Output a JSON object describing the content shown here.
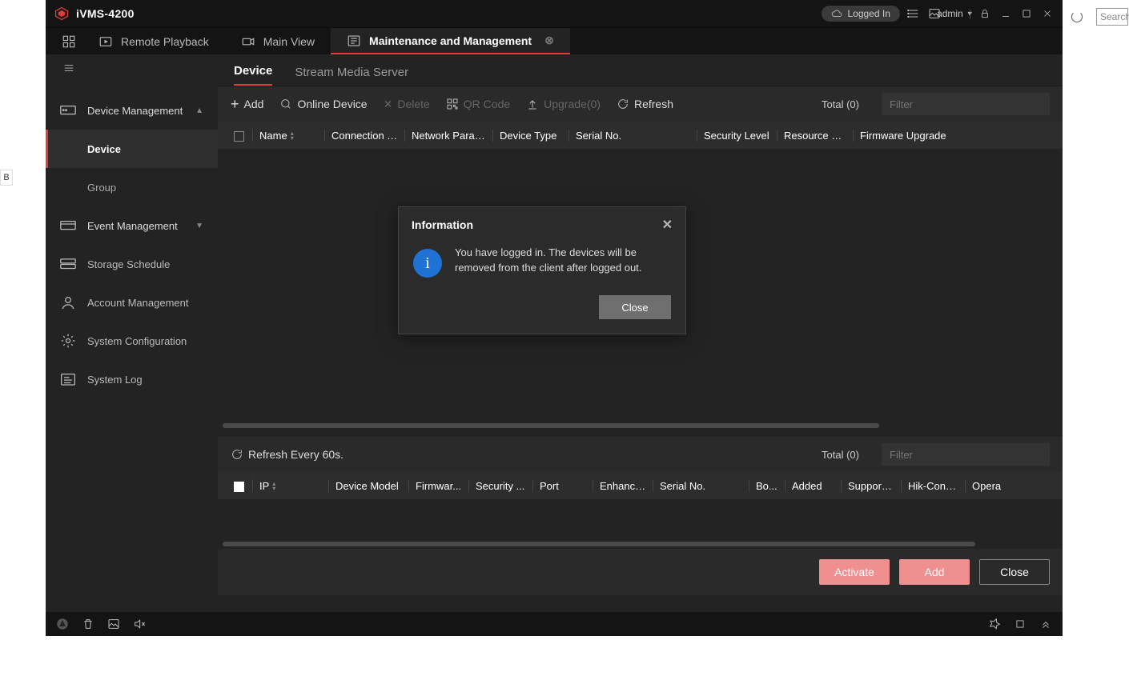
{
  "app": {
    "title": "iVMS-4200"
  },
  "titlebar": {
    "logged_pill": "Logged In",
    "user": "admin"
  },
  "tabs": {
    "remote_playback": "Remote Playback",
    "main_view": "Main View",
    "maintenance": "Maintenance and Management"
  },
  "sidebar": {
    "device_management": "Device Management",
    "device": "Device",
    "group": "Group",
    "event_management": "Event Management",
    "storage_schedule": "Storage Schedule",
    "account_management": "Account Management",
    "system_configuration": "System Configuration",
    "system_log": "System Log"
  },
  "subtabs": {
    "device": "Device",
    "sms": "Stream Media Server"
  },
  "toolbar": {
    "add": "Add",
    "online_device": "Online Device",
    "delete": "Delete",
    "qr_code": "QR Code",
    "upgrade": "Upgrade(0)",
    "refresh": "Refresh",
    "total": "Total (0)",
    "filter_placeholder": "Filter"
  },
  "upper_columns": {
    "name": "Name",
    "connection": "Connection T...",
    "network": "Network Param...",
    "device_type": "Device Type",
    "serial": "Serial No.",
    "security": "Security Level",
    "resource": "Resource Us...",
    "firmware": "Firmware Upgrade"
  },
  "lower_toolbar": {
    "refresh60": "Refresh Every 60s.",
    "total": "Total (0)",
    "filter_placeholder": "Filter"
  },
  "lower_columns": {
    "ip": "IP",
    "device_model": "Device Model",
    "firmware": "Firmwar...",
    "security": "Security ...",
    "port": "Port",
    "enhanced": "Enhance...",
    "serial": "Serial No.",
    "boot": "Bo...",
    "added": "Added",
    "support": "Support ...",
    "hikconn": "Hik-Conn...",
    "operation": "Opera"
  },
  "lower_actions": {
    "activate": "Activate",
    "add": "Add",
    "close": "Close"
  },
  "modal": {
    "title": "Information",
    "text": "You have logged in. The devices will be removed from the client after logged out.",
    "close_btn": "Close"
  },
  "outer": {
    "search_placeholder": "Search"
  }
}
